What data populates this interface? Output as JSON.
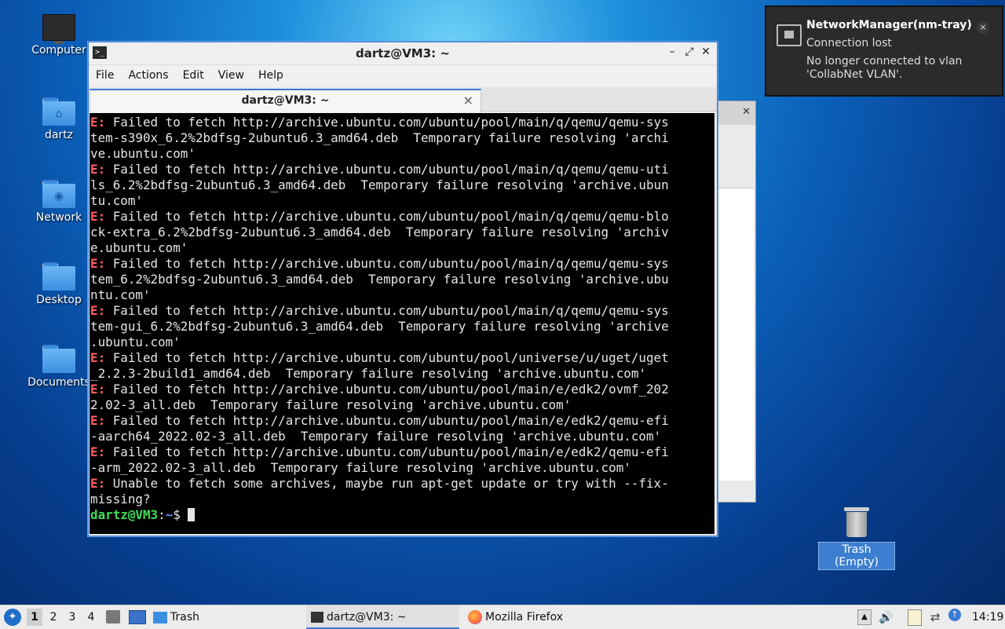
{
  "desktop": {
    "icons": [
      {
        "label": "Computer",
        "icon": "computer-icon"
      },
      {
        "label": "dartz",
        "icon": "home-folder-icon"
      },
      {
        "label": "Network",
        "icon": "network-folder-icon"
      },
      {
        "label": "Desktop",
        "icon": "folder-icon"
      },
      {
        "label": "Documents",
        "icon": "folder-icon"
      }
    ],
    "trash_label": "Trash (Empty)"
  },
  "terminal": {
    "title": "dartz@VM3: ~",
    "menu": [
      "File",
      "Actions",
      "Edit",
      "View",
      "Help"
    ],
    "tab_label": "dartz@VM3: ~",
    "lines": [
      {
        "prefix": "E:",
        "text": " Failed to fetch http://archive.ubuntu.com/ubuntu/pool/main/q/qemu/qemu-sys"
      },
      {
        "prefix": "",
        "text": "tem-s390x_6.2%2bdfsg-2ubuntu6.3_amd64.deb  Temporary failure resolving 'archi"
      },
      {
        "prefix": "",
        "text": "ve.ubuntu.com'"
      },
      {
        "prefix": "E:",
        "text": " Failed to fetch http://archive.ubuntu.com/ubuntu/pool/main/q/qemu/qemu-uti"
      },
      {
        "prefix": "",
        "text": "ls_6.2%2bdfsg-2ubuntu6.3_amd64.deb  Temporary failure resolving 'archive.ubun"
      },
      {
        "prefix": "",
        "text": "tu.com'"
      },
      {
        "prefix": "E:",
        "text": " Failed to fetch http://archive.ubuntu.com/ubuntu/pool/main/q/qemu/qemu-blo"
      },
      {
        "prefix": "",
        "text": "ck-extra_6.2%2bdfsg-2ubuntu6.3_amd64.deb  Temporary failure resolving 'archiv"
      },
      {
        "prefix": "",
        "text": "e.ubuntu.com'"
      },
      {
        "prefix": "E:",
        "text": " Failed to fetch http://archive.ubuntu.com/ubuntu/pool/main/q/qemu/qemu-sys"
      },
      {
        "prefix": "",
        "text": "tem_6.2%2bdfsg-2ubuntu6.3_amd64.deb  Temporary failure resolving 'archive.ubu"
      },
      {
        "prefix": "",
        "text": "ntu.com'"
      },
      {
        "prefix": "E:",
        "text": " Failed to fetch http://archive.ubuntu.com/ubuntu/pool/main/q/qemu/qemu-sys"
      },
      {
        "prefix": "",
        "text": "tem-gui_6.2%2bdfsg-2ubuntu6.3_amd64.deb  Temporary failure resolving 'archive"
      },
      {
        "prefix": "",
        "text": ".ubuntu.com'"
      },
      {
        "prefix": "E:",
        "text": " Failed to fetch http://archive.ubuntu.com/ubuntu/pool/universe/u/uget/uget"
      },
      {
        "prefix": "",
        "text": "_2.2.3-2build1_amd64.deb  Temporary failure resolving 'archive.ubuntu.com'"
      },
      {
        "prefix": "E:",
        "text": " Failed to fetch http://archive.ubuntu.com/ubuntu/pool/main/e/edk2/ovmf_202"
      },
      {
        "prefix": "",
        "text": "2.02-3_all.deb  Temporary failure resolving 'archive.ubuntu.com'"
      },
      {
        "prefix": "E:",
        "text": " Failed to fetch http://archive.ubuntu.com/ubuntu/pool/main/e/edk2/qemu-efi"
      },
      {
        "prefix": "",
        "text": "-aarch64_2022.02-3_all.deb  Temporary failure resolving 'archive.ubuntu.com'"
      },
      {
        "prefix": "E:",
        "text": " Failed to fetch http://archive.ubuntu.com/ubuntu/pool/main/e/edk2/qemu-efi"
      },
      {
        "prefix": "",
        "text": "-arm_2022.02-3_all.deb  Temporary failure resolving 'archive.ubuntu.com'"
      },
      {
        "prefix": "E:",
        "text": " Unable to fetch some archives, maybe run apt-get update or try with --fix-"
      },
      {
        "prefix": "",
        "text": "missing?"
      }
    ],
    "prompt_user": "dartz@VM3",
    "prompt_sep": ":",
    "prompt_path": "~",
    "prompt_symbol": "$ "
  },
  "notification": {
    "app": "NetworkManager(nm-tray)",
    "summary": "Connection lost",
    "body": "No longer connected to vlan 'CollabNet VLAN'.",
    "close_glyph": "×"
  },
  "taskbar": {
    "workspaces": [
      "1",
      "2",
      "3",
      "4"
    ],
    "active_workspace": "1",
    "trash_launcher": "Trash",
    "tasks": [
      {
        "label": "dartz@VM3: ~",
        "icon": "terminal-icon"
      },
      {
        "label": "Mozilla Firefox",
        "icon": "firefox-icon"
      }
    ],
    "clock": "14:19"
  },
  "colors": {
    "accent": "#3a7bd5",
    "error_prefix": "#ff5f5f",
    "prompt_user": "#3ddf55",
    "prompt_path": "#5c9cff"
  }
}
